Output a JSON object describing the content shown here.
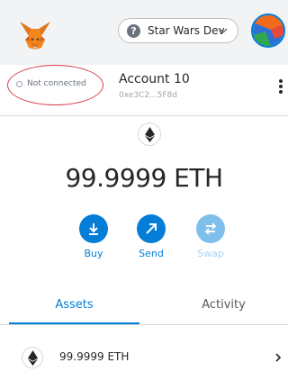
{
  "header": {
    "network_label": "Star Wars Dev",
    "network_icon": "question-icon",
    "network_icon_glyph": "?"
  },
  "account": {
    "connection_status": "Not connected",
    "name": "Account 10",
    "address": "0xe3C2...5F8d"
  },
  "balance": {
    "amount": "99.9999 ETH"
  },
  "actions": [
    {
      "label": "Buy",
      "icon": "download-icon",
      "enabled": true
    },
    {
      "label": "Send",
      "icon": "arrow-up-right-icon",
      "enabled": true
    },
    {
      "label": "Swap",
      "icon": "swap-icon",
      "enabled": false
    }
  ],
  "tabs": [
    {
      "label": "Assets",
      "active": true
    },
    {
      "label": "Activity",
      "active": false
    }
  ],
  "assets": [
    {
      "amount": "99.9999 ETH",
      "icon": "ethereum-icon"
    }
  ],
  "colors": {
    "accent": "#037dd6",
    "accent_disabled": "#7fbfeb",
    "header_bg": "#f2f3f4",
    "annotation_red": "#d73a49"
  }
}
